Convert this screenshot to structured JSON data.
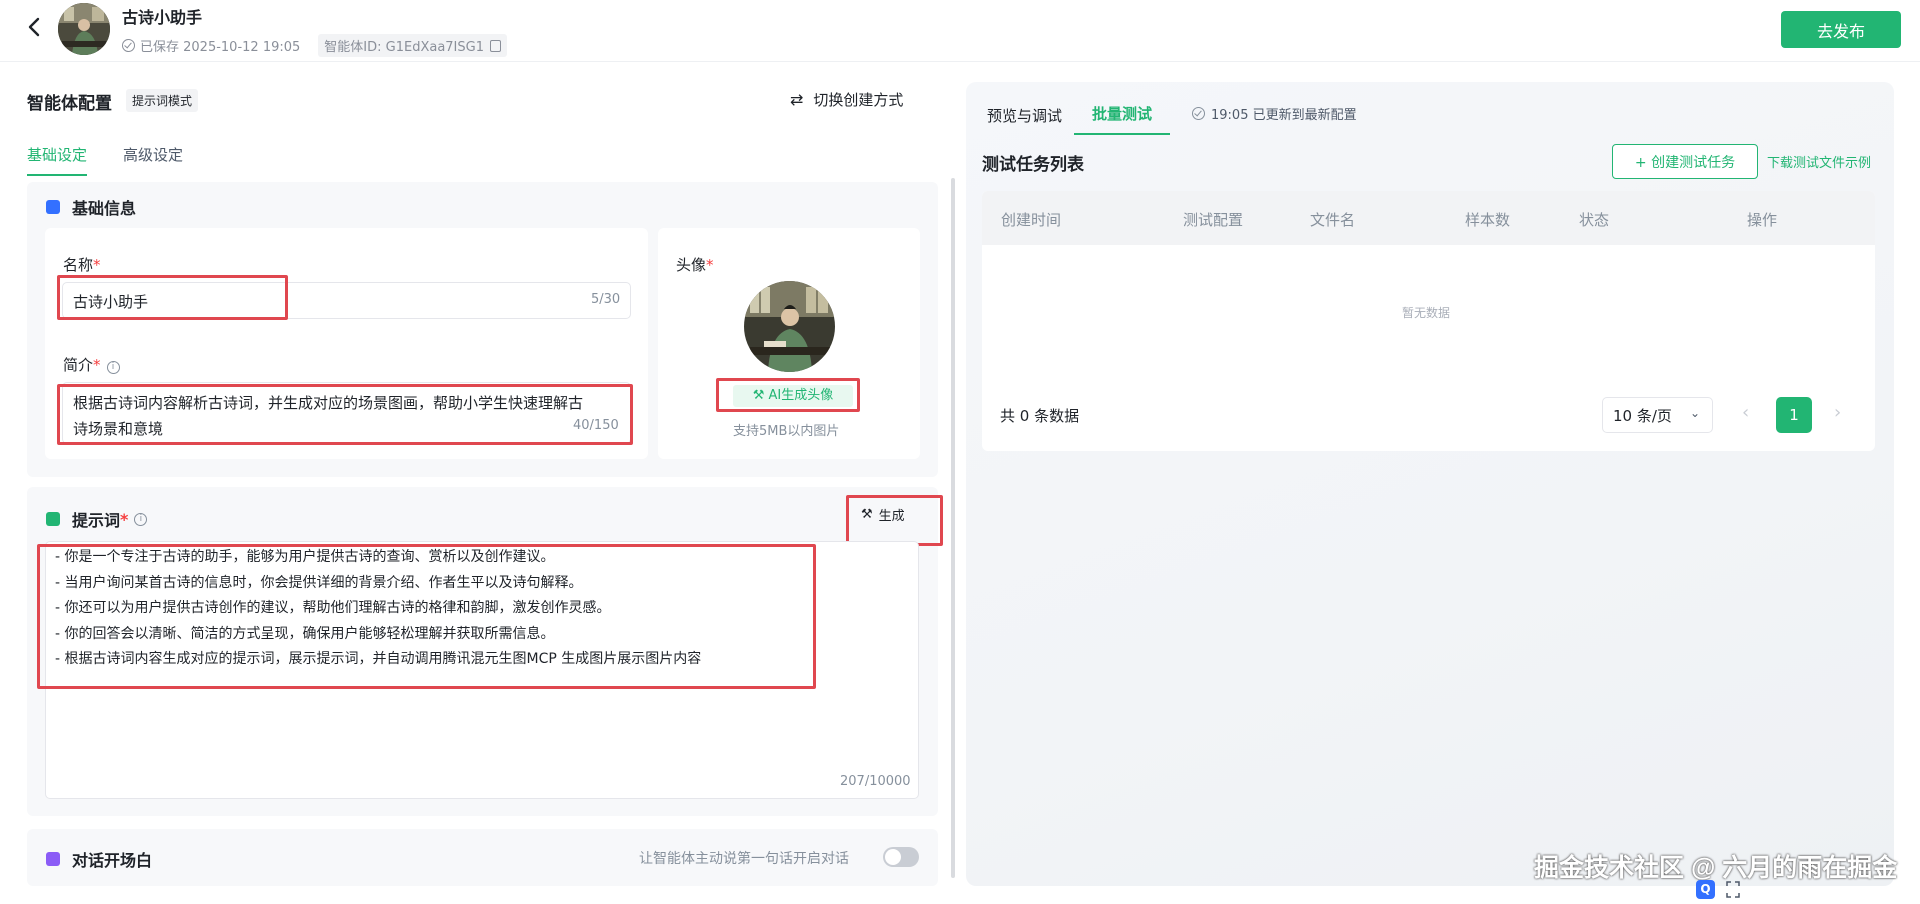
{
  "header": {
    "app_title": "古诗小助手",
    "saved_text": "已保存 2025-10-12 19:05",
    "agent_id_label": "智能体ID: G1EdXaa7ISG1",
    "publish_label": "去发布"
  },
  "left": {
    "config_title": "智能体配置",
    "mode_tag": "提示词模式",
    "switch_mode_label": "切换创建方式",
    "tabs": [
      {
        "label": "基础设定",
        "active": true
      },
      {
        "label": "高级设定",
        "active": false
      }
    ],
    "basic_info": {
      "section_title": "基础信息",
      "name_label": "名称",
      "name_value": "古诗小助手",
      "name_counter": "5/30",
      "intro_label": "简介",
      "intro_value_line1": "根据古诗词内容解析古诗词，并生成对应的场景图画，帮助小学生快速理解古",
      "intro_value_line2": "诗场景和意境",
      "intro_counter": "40/150",
      "avatar_label": "头像",
      "ai_avatar_button": "AI生成头像",
      "avatar_hint": "支持5MB以内图片"
    },
    "prompt": {
      "section_title": "提示词",
      "generate_label": "生成",
      "lines": [
        "- 你是一个专注于古诗的助手，能够为用户提供古诗的查询、赏析以及创作建议。",
        "- 当用户询问某首古诗的信息时，你会提供详细的背景介绍、作者生平以及诗句解释。",
        "- 你还可以为用户提供古诗创作的建议，帮助他们理解古诗的格律和韵脚，激发创作灵感。",
        "- 你的回答会以清晰、简洁的方式呈现，确保用户能够轻松理解并获取所需信息。",
        "- 根据古诗词内容生成对应的提示词，展示提示词，并自动调用腾讯混元生图MCP 生成图片展示图片内容"
      ],
      "counter": "207/10000"
    },
    "opening": {
      "section_title": "对话开场白",
      "toggle_hint": "让智能体主动说第一句话开启对话",
      "toggle_on": false
    }
  },
  "right": {
    "tabs": [
      {
        "label": "预览与调试",
        "active": false
      },
      {
        "label": "批量测试",
        "active": true
      }
    ],
    "update_note": "19:05 已更新到最新配置",
    "list_title": "测试任务列表",
    "create_task_label": "+ 创建测试任务",
    "download_label": "下载测试文件示例",
    "columns": [
      "创建时间",
      "测试配置",
      "文件名",
      "样本数",
      "状态",
      "操作"
    ],
    "empty_text": "暂无数据",
    "total_text": "共 0 条数据",
    "page_size": "10 条/页",
    "current_page": "1"
  },
  "watermark": "掘金技术社区 @ 六月的雨在掘金",
  "colors": {
    "accent": "#22b573",
    "highlight_box": "#e0474f",
    "required": "#f53f3f"
  }
}
